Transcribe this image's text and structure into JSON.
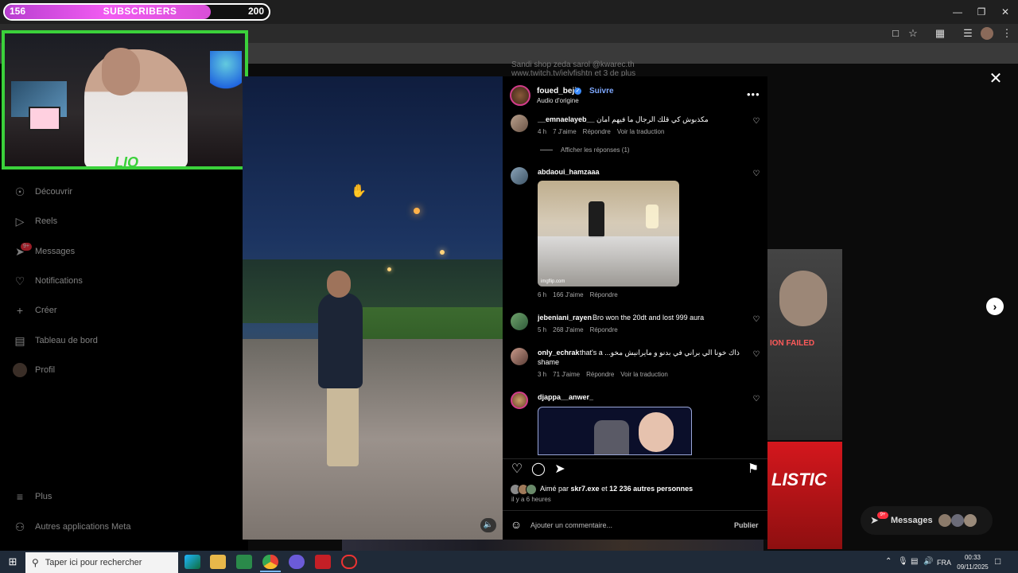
{
  "subscriber_goal": {
    "current": "156",
    "label": "SUBSCRIBERS",
    "goal": "200",
    "progress_fraction": 0.78
  },
  "webcam_overlay": {
    "logo_text": "LIO"
  },
  "browser": {
    "window_controls": [
      "minimize",
      "restore",
      "close"
    ],
    "toolbar_icons": [
      "install-app-icon",
      "bookmark-star-icon",
      "extensions-icon",
      "media-control-icon",
      "profile-icon",
      "menu-icon"
    ]
  },
  "sidebar": {
    "items": [
      {
        "icon": "compass-icon",
        "label": "Découvrir"
      },
      {
        "icon": "reels-icon",
        "label": "Reels"
      },
      {
        "icon": "messages-icon",
        "label": "Messages",
        "badge": "9+"
      },
      {
        "icon": "heart-icon",
        "label": "Notifications"
      },
      {
        "icon": "plus-icon",
        "label": "Créer"
      },
      {
        "icon": "dashboard-icon",
        "label": "Tableau de bord"
      },
      {
        "icon": "profile-avatar-icon",
        "label": "Profil"
      },
      {
        "icon": "hamburger-icon",
        "label": "Plus"
      },
      {
        "icon": "meta-apps-icon",
        "label": "Autres applications Meta"
      }
    ]
  },
  "background": {
    "meta_line_1": "Sandi shop zeda sarol @kwarec.th",
    "meta_line_2": "www.twitch.tv/ielvfishtn et 3 de plus",
    "card1_text": "ION FAILED",
    "card2_text": "LISTIC"
  },
  "post": {
    "username": "foued_beji",
    "follow_label": "Suivre",
    "audio_label": "Audio d'origine",
    "more_label": "•••"
  },
  "comments": [
    {
      "username": "__emnaelayeb__",
      "text": "مكذبوش كي قلك الرجال ما فيهم امان",
      "time": "4 h",
      "likes": "7 J'aime",
      "reply": "Répondre",
      "translate": "Voir la traduction",
      "view_replies": "Afficher les réponses (1)"
    },
    {
      "username": "abdaoui_hamzaaa",
      "text": "",
      "gif_watermark": "imgflip.com",
      "time": "6 h",
      "likes": "166 J'aime",
      "reply": "Répondre"
    },
    {
      "username": "jebeniani_rayen",
      "text": "Bro won the 20dt and lost 999 aura",
      "time": "5 h",
      "likes": "268 J'aime",
      "reply": "Répondre"
    },
    {
      "username": "only_echrak",
      "text": "that's a ...ذاك خونا الي براني في بدنو و مايرانيش مخو",
      "text_line2": "shame",
      "time": "3 h",
      "likes": "71 J'aime",
      "reply": "Répondre",
      "translate": "Voir la traduction"
    },
    {
      "username": "djappa__anwer_",
      "text": ""
    }
  ],
  "actions": {
    "liked_by_prefix": "Aimé par",
    "liked_by_user": "skr7.exe",
    "liked_by_connector": "et",
    "liked_by_others": "12 236 autres personnes",
    "post_time": "il y a 6 heures",
    "comment_placeholder": "Ajouter un commentaire...",
    "publish_label": "Publier"
  },
  "floating_messages": {
    "label": "Messages",
    "badge": "9+"
  },
  "taskbar": {
    "search_placeholder": "Taper ici pour rechercher",
    "language": "FRA",
    "time": "00:33",
    "date": "09/11/2025"
  },
  "colors": {
    "progress_fill": "#f25cf2",
    "webcam_border": "#3bd13b",
    "follow_blue": "#7fa9ff",
    "verified_blue": "#3b8cff",
    "notification_red": "#ff3040"
  }
}
